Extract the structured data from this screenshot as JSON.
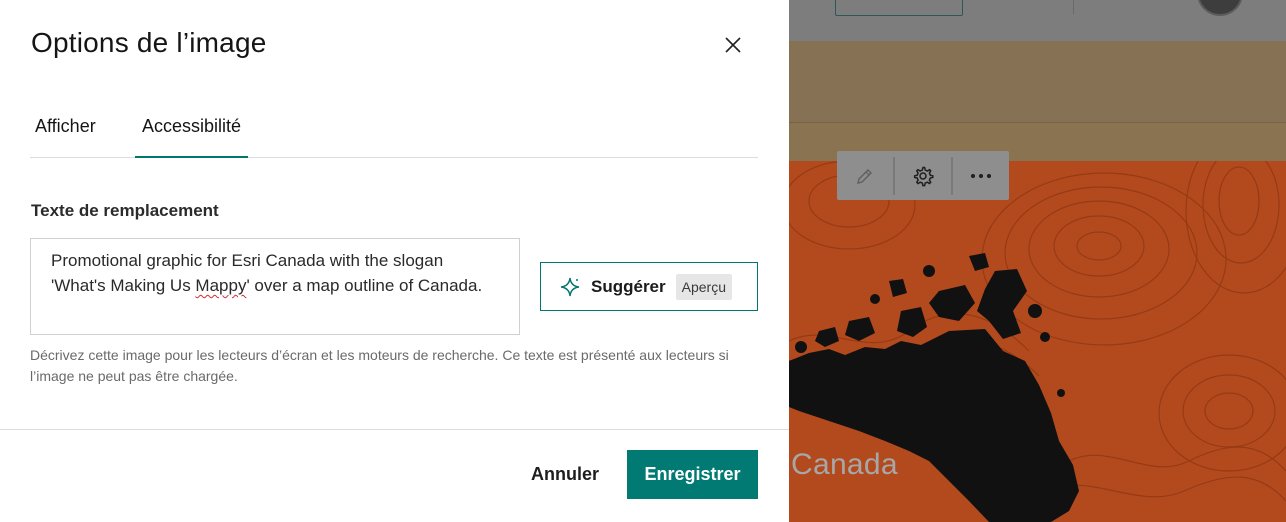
{
  "dialog": {
    "title": "Options de l’image",
    "close_icon": "close-icon"
  },
  "tabs": [
    {
      "label": "Afficher",
      "active": false
    },
    {
      "label": "Accessibilité",
      "active": true
    }
  ],
  "alt_text": {
    "label": "Texte de remplacement",
    "value_before": "Promotional graphic for Esri Canada with the slogan 'What's Making Us ",
    "value_misspelled": "Mappy",
    "value_after": "' over a map outline of Canada.",
    "help": "Décrivez cette image pour les lecteurs d’écran et les moteurs de recherche. Ce texte est présenté aux lecteurs si l’image ne peut pas être chargée."
  },
  "suggest": {
    "label": "Suggérer",
    "badge": "Aperçu",
    "icon": "sparkle-icon"
  },
  "footer": {
    "cancel_label": "Annuler",
    "save_label": "Enregistrer"
  },
  "background": {
    "map_text": "Canada",
    "toolbar_icons": [
      "pencil-icon",
      "gear-icon",
      "more-icon"
    ]
  },
  "colors": {
    "accent": "#007a73",
    "map_orange": "#b24a1d"
  }
}
